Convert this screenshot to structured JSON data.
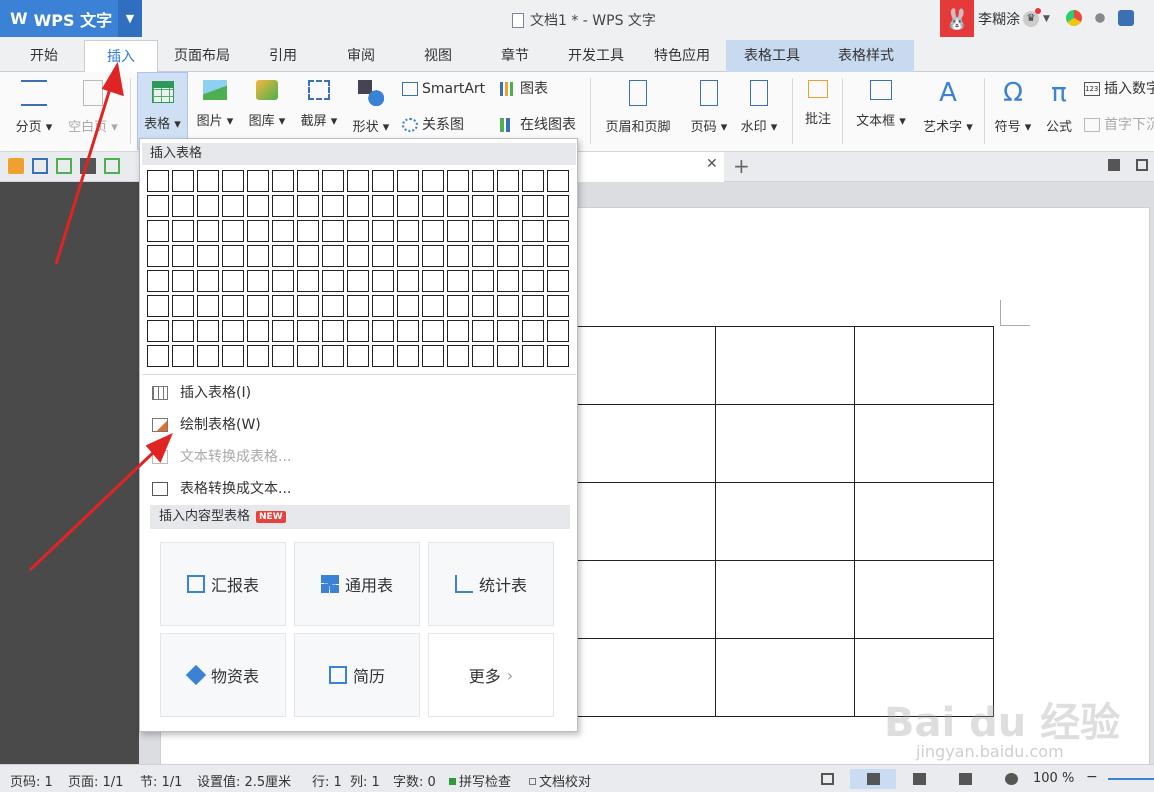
{
  "titlebar": {
    "app_logo": "W",
    "app_name": "WPS 文字",
    "doc_title": "文档1 * - WPS 文字",
    "user_name": "李糊涂"
  },
  "tabs": [
    "开始",
    "插入",
    "页面布局",
    "引用",
    "审阅",
    "视图",
    "章节",
    "开发工具",
    "特色应用",
    "表格工具",
    "表格样式"
  ],
  "active_tab": "插入",
  "ribbon": {
    "page_break": "分页",
    "blank_page": "空白页",
    "table": "表格",
    "picture": "图片",
    "gallery": "图库",
    "screenshot": "截屏",
    "shapes": "形状",
    "smartart": "SmartArt",
    "chart": "图表",
    "relation_chart": "关系图",
    "online_chart": "在线图表",
    "header_footer": "页眉和页脚",
    "page_number": "页码",
    "watermark": "水印",
    "comment": "批注",
    "textbox": "文本框",
    "wordart": "艺术字",
    "symbol": "符号",
    "formula": "公式",
    "insert_number": "插入数字",
    "drop_cap": "首字下沉"
  },
  "dropdown": {
    "header": "插入表格",
    "items": {
      "insert_table": "插入表格(I)",
      "draw_table": "绘制表格(W)",
      "text_to_table": "文本转换成表格...",
      "table_to_text": "表格转换成文本..."
    },
    "content_header": "插入内容型表格",
    "new_badge": "NEW",
    "cards": {
      "report": "汇报表",
      "general": "通用表",
      "stats": "统计表",
      "materials": "物资表",
      "resume": "简历",
      "more": "更多"
    }
  },
  "statusbar": {
    "page_num": "页码: 1",
    "pages": "页面: 1/1",
    "section": "节: 1/1",
    "setting": "设置值: 2.5厘米",
    "row": "行: 1",
    "col": "列: 1",
    "words": "字数: 0",
    "spell": "拼写检查",
    "doc_check": "文档校对",
    "zoom": "100 %"
  },
  "watermark": {
    "brand": "Bai du 经验",
    "url": "jingyan.baidu.com"
  },
  "colors": {
    "accent": "#3b82d6",
    "arrow": "#e02424",
    "table_tool_tab": "#c8daf0"
  }
}
